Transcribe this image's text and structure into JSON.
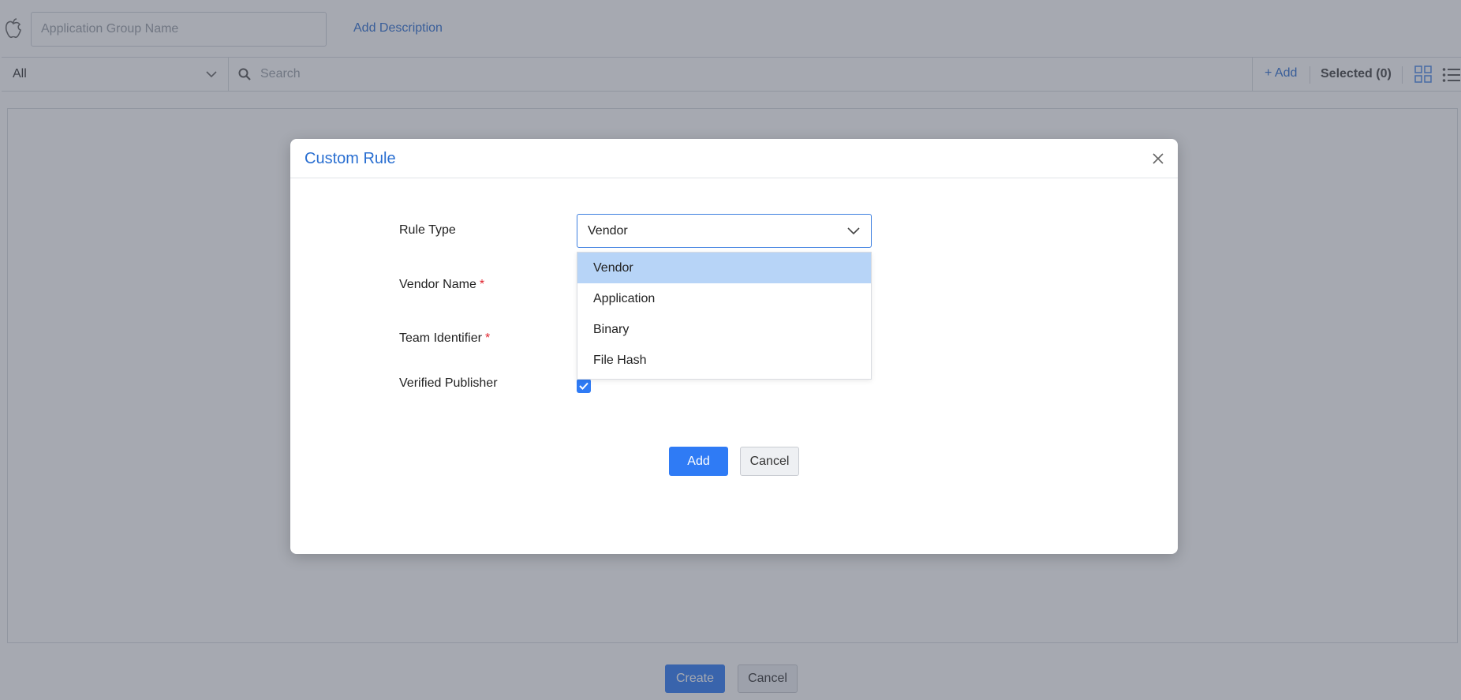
{
  "header": {
    "group_name_placeholder": "Application Group Name",
    "add_description_label": "Add Description"
  },
  "toolbar": {
    "filter_value": "All",
    "search_placeholder": "Search",
    "add_label": "+ Add",
    "selected_label": "Selected (0)"
  },
  "footer": {
    "create_label": "Create",
    "cancel_label": "Cancel"
  },
  "modal": {
    "title": "Custom Rule",
    "fields": {
      "rule_type_label": "Rule Type",
      "rule_type_value": "Vendor",
      "vendor_name_label": "Vendor Name",
      "team_identifier_label": "Team Identifier",
      "verified_publisher_label": "Verified Publisher",
      "required_marker": "*",
      "verified_publisher_checked": true
    },
    "dropdown_options": [
      {
        "label": "Vendor",
        "selected": true
      },
      {
        "label": "Application",
        "selected": false
      },
      {
        "label": "Binary",
        "selected": false
      },
      {
        "label": "File Hash",
        "selected": false
      }
    ],
    "add_label": "Add",
    "cancel_label": "Cancel"
  },
  "colors": {
    "accent": "#2f7bf5",
    "link": "#2f6fd1",
    "selected_option": "#b7d4f7",
    "required": "#e0242e"
  },
  "icons": {
    "app_logo": "apple-icon",
    "search": "search-icon",
    "dropdown": "chevron-down-icon",
    "close": "close-icon",
    "grid_view": "grid-view-icon",
    "list_view": "list-view-icon",
    "checkbox": "checkmark-icon"
  }
}
